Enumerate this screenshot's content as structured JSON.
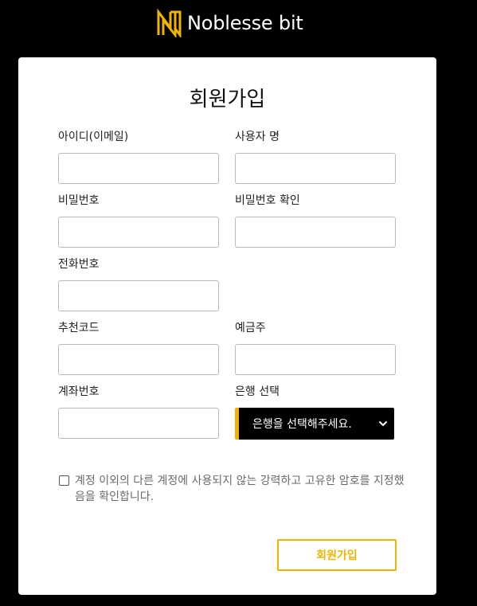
{
  "header": {
    "brand_name": "Noblesse bit",
    "logo_icon": "noblesse-n-logo",
    "accent_color": "#f0b400"
  },
  "form": {
    "title": "회원가입",
    "fields": {
      "user_id": {
        "label": "아이디(이메일)",
        "value": "",
        "placeholder": ""
      },
      "username": {
        "label": "사용자 명",
        "value": "",
        "placeholder": ""
      },
      "password": {
        "label": "비밀번호",
        "value": "",
        "placeholder": ""
      },
      "password_confirm": {
        "label": "비밀번호 확인",
        "value": "",
        "placeholder": ""
      },
      "phone": {
        "label": "전화번호",
        "value": "",
        "placeholder": ""
      },
      "referral_code": {
        "label": "추천코드",
        "value": "",
        "placeholder": ""
      },
      "account_holder": {
        "label": "예금주",
        "value": "",
        "placeholder": ""
      },
      "account_number": {
        "label": "계좌번호",
        "value": "",
        "placeholder": ""
      }
    },
    "bank_select": {
      "label": "은행 선택",
      "selected": "은행을 선택해주세요.",
      "icon": "chevron-down-icon"
    },
    "agreement_text": "계정 이외의 다른 계정에 사용되지 않는 강력하고 고유한 암호를 지정했음을 확인합니다.",
    "agreement_checked": false,
    "submit_label": "회원가입"
  }
}
